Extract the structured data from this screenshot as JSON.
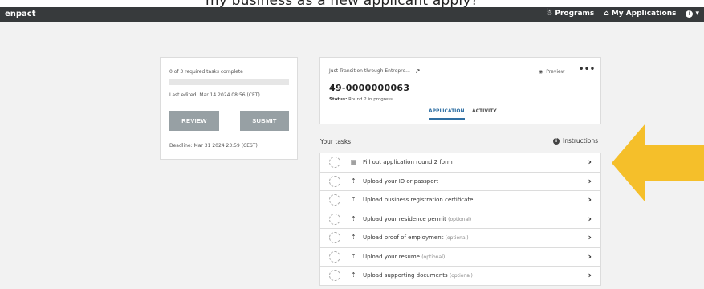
{
  "banner": {
    "text": "my business as a new applicant apply?"
  },
  "nav": {
    "brand": "enpact",
    "programs": "Programs",
    "my_applications": "My Applications",
    "info_icon": "info-icon",
    "caret": "▾"
  },
  "status": {
    "tasks_complete": "0 of 3 required tasks complete",
    "progress_fraction": 0,
    "last_edited": "Last edited: Mar 14 2024 08:56 (CET)",
    "review_label": "REVIEW",
    "submit_label": "SUBMIT",
    "deadline": "Deadline: Mar 31 2024 23:59 (CEST)"
  },
  "application": {
    "program_title": "Just Transition through Entrepre...",
    "preview_label": "Preview",
    "more_label": "•••",
    "number": "49-0000000063",
    "status_label": "Status:",
    "status_value": "Round 2 in progress",
    "tabs": [
      "APPLICATION",
      "ACTIVITY"
    ],
    "active_tab": "APPLICATION"
  },
  "tasks_header": {
    "title": "Your tasks",
    "instructions": "Instructions"
  },
  "tasks": [
    {
      "label": "Fill out application round 2 form",
      "optional": "",
      "icon": "form-icon"
    },
    {
      "label": "Upload your ID or passport",
      "optional": "",
      "icon": "upload-icon"
    },
    {
      "label": "Upload business registration certificate",
      "optional": "",
      "icon": "upload-icon"
    },
    {
      "label": "Upload your residence permit",
      "optional": "(optional)",
      "icon": "upload-icon"
    },
    {
      "label": "Upload proof of employment",
      "optional": "(optional)",
      "icon": "upload-icon"
    },
    {
      "label": "Upload your resume",
      "optional": "(optional)",
      "icon": "upload-icon"
    },
    {
      "label": "Upload supporting documents",
      "optional": "(optional)",
      "icon": "upload-icon"
    }
  ],
  "colors": {
    "navbar": "#373a3c",
    "button": "#97a0a4",
    "arrow": "#f5bf2a",
    "accent": "#2f6fa3"
  }
}
